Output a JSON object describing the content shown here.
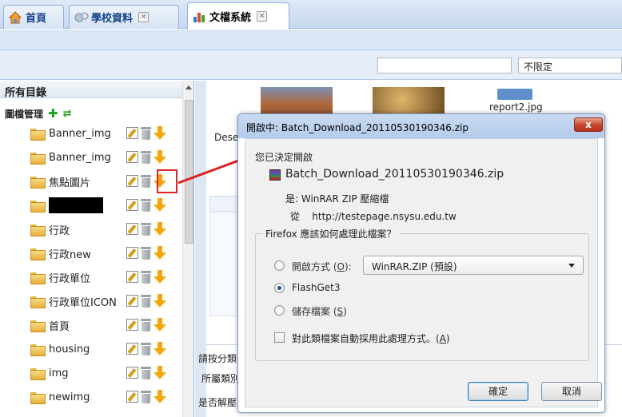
{
  "tabs": [
    {
      "label": "首頁",
      "icon": "home-icon"
    },
    {
      "label": "學校資料",
      "icon": "gears-icon",
      "close": "✕"
    },
    {
      "label": "文檔系統",
      "icon": "bar-chart-icon",
      "close": "✕"
    }
  ],
  "toolbar": {
    "filter_value": "不限定"
  },
  "tree": {
    "header": "所有目錄",
    "root_label": "圖檔管理",
    "items": [
      {
        "label": "Banner_img"
      },
      {
        "label": "Banner_img"
      },
      {
        "label": "焦點圖片"
      },
      {
        "label": ""
      },
      {
        "label": "行政"
      },
      {
        "label": "行政new"
      },
      {
        "label": "行政單位"
      },
      {
        "label": "行政單位ICON"
      },
      {
        "label": "首頁"
      },
      {
        "label": "housing"
      },
      {
        "label": "img"
      },
      {
        "label": "newimg"
      }
    ]
  },
  "content": {
    "file_label_1": "Dese",
    "file_label_2": "report2.jpg",
    "row1": "請按分類",
    "row2": "所屬類別",
    "row3": "是否解壓"
  },
  "dialog": {
    "title": "開啟中: Batch_Download_20110530190346.zip",
    "close_label": "x",
    "opening_text": "您已決定開啟",
    "file_name": "Batch_Download_20110530190346.zip",
    "is_label": "是: WinRAR ZIP 壓縮檔",
    "from_label": "從",
    "from_url": "http://testepage.nsysu.edu.tw",
    "question": "Firefox 應該如何處理此檔案？",
    "option_open": "開啟方式 (",
    "option_open_key": "O",
    "option_open_end": "):",
    "open_with_value": "WinRAR.ZIP (預設)",
    "option_flashget": "FlashGet3",
    "option_save": "儲存檔案 (",
    "option_save_key": "S",
    "option_save_end": ")",
    "selected_option": "FlashGet3",
    "checkbox_label": "對此類檔案自動採用此處理方式。(",
    "checkbox_key": "A",
    "checkbox_end": ")",
    "ok_label": "確定",
    "cancel_label": "取消"
  },
  "colors": {
    "highlight": "#dd2222",
    "tab_bg": "#dfe8f6"
  }
}
